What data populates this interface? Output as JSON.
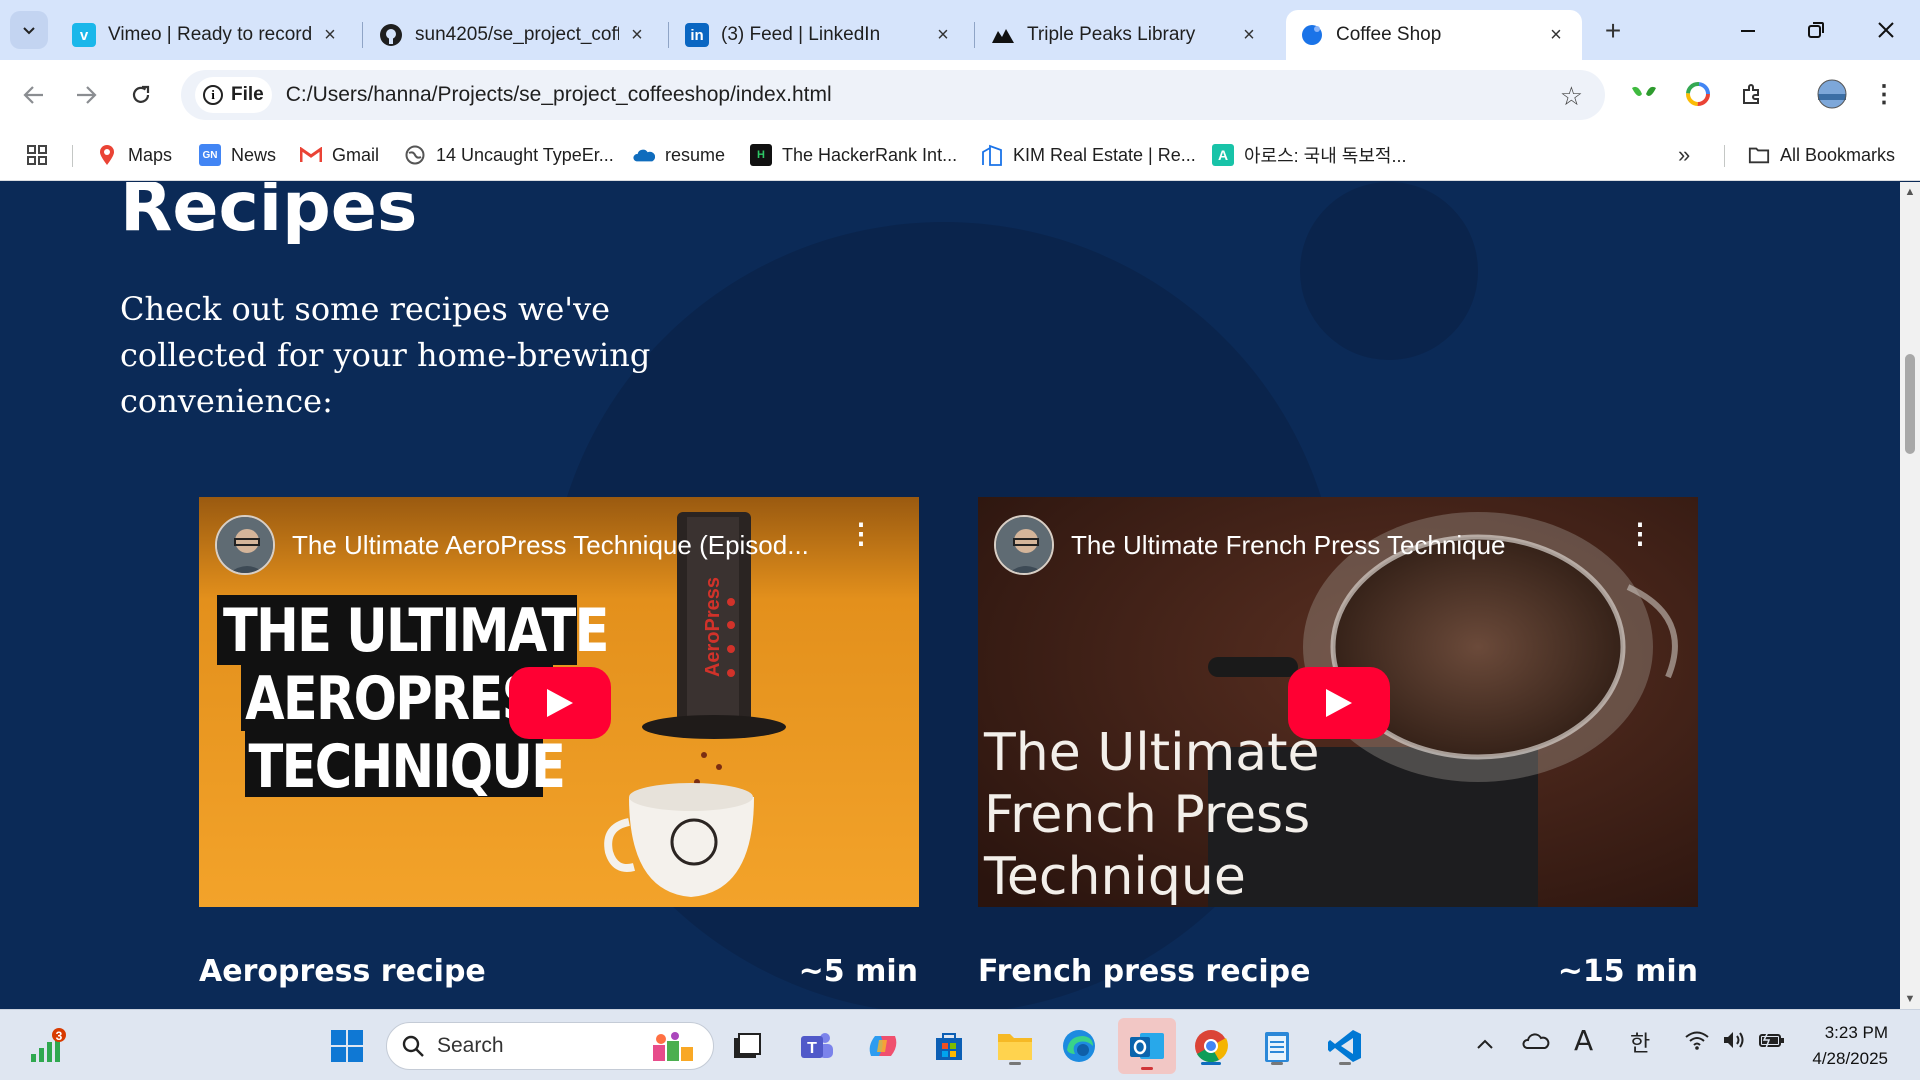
{
  "browser": {
    "tabs": [
      {
        "title": "Vimeo | Ready to record",
        "icon": "vimeo-icon",
        "color": "#1ab7ea"
      },
      {
        "title": "sun4205/se_project_coffe",
        "icon": "github-icon",
        "color": "#1f1f1f"
      },
      {
        "title": "(3) Feed | LinkedIn",
        "icon": "linkedin-icon",
        "color": "#0a66c2"
      },
      {
        "title": "Triple Peaks Library",
        "icon": "mountain-icon",
        "color": "#111111"
      },
      {
        "title": "Coffee Shop",
        "icon": "globe-icon",
        "color": "#1a73e8"
      }
    ],
    "address": {
      "chip_label": "File",
      "url": "C:/Users/hanna/Projects/se_project_coffeeshop/index.html"
    },
    "bookmarks": [
      {
        "label": "Maps",
        "icon": "maps-icon"
      },
      {
        "label": "News",
        "icon": "news-icon"
      },
      {
        "label": "Gmail",
        "icon": "gmail-icon"
      },
      {
        "label": "14 Uncaught TypeEr...",
        "icon": "globe-icon"
      },
      {
        "label": "resume",
        "icon": "onedrive-icon"
      },
      {
        "label": "The HackerRank Int...",
        "icon": "hackerrank-icon"
      },
      {
        "label": "KIM Real Estate | Re...",
        "icon": "building-icon"
      },
      {
        "label": "아로스: 국내 독보적...",
        "icon": "a-icon"
      }
    ],
    "all_bookmarks": "All Bookmarks",
    "overflow": "»"
  },
  "page": {
    "heading": "Recipes",
    "intro": "Check out some recipes we've collected for your home-brewing convenience:",
    "videos": [
      {
        "title": "The Ultimate AeroPress Technique (Episod...",
        "thumb_text": [
          "THE ULTIMATE",
          "AEROPRESS",
          "TECHNIQUE"
        ],
        "recipe": "Aeropress recipe",
        "time": "~5 min"
      },
      {
        "title": "The Ultimate French Press Technique",
        "thumb_text": [
          "The Ultimate",
          "French Press",
          "Technique"
        ],
        "recipe": "French press recipe",
        "time": "~15 min"
      }
    ],
    "colors": {
      "background": "#0b2a57",
      "youtube_red": "#ff0033"
    }
  },
  "taskbar": {
    "search_label": "Search",
    "widget_badge": "3",
    "tray_ime": "한",
    "tray_font": "A",
    "time": "3:23 PM",
    "date": "4/28/2025"
  }
}
